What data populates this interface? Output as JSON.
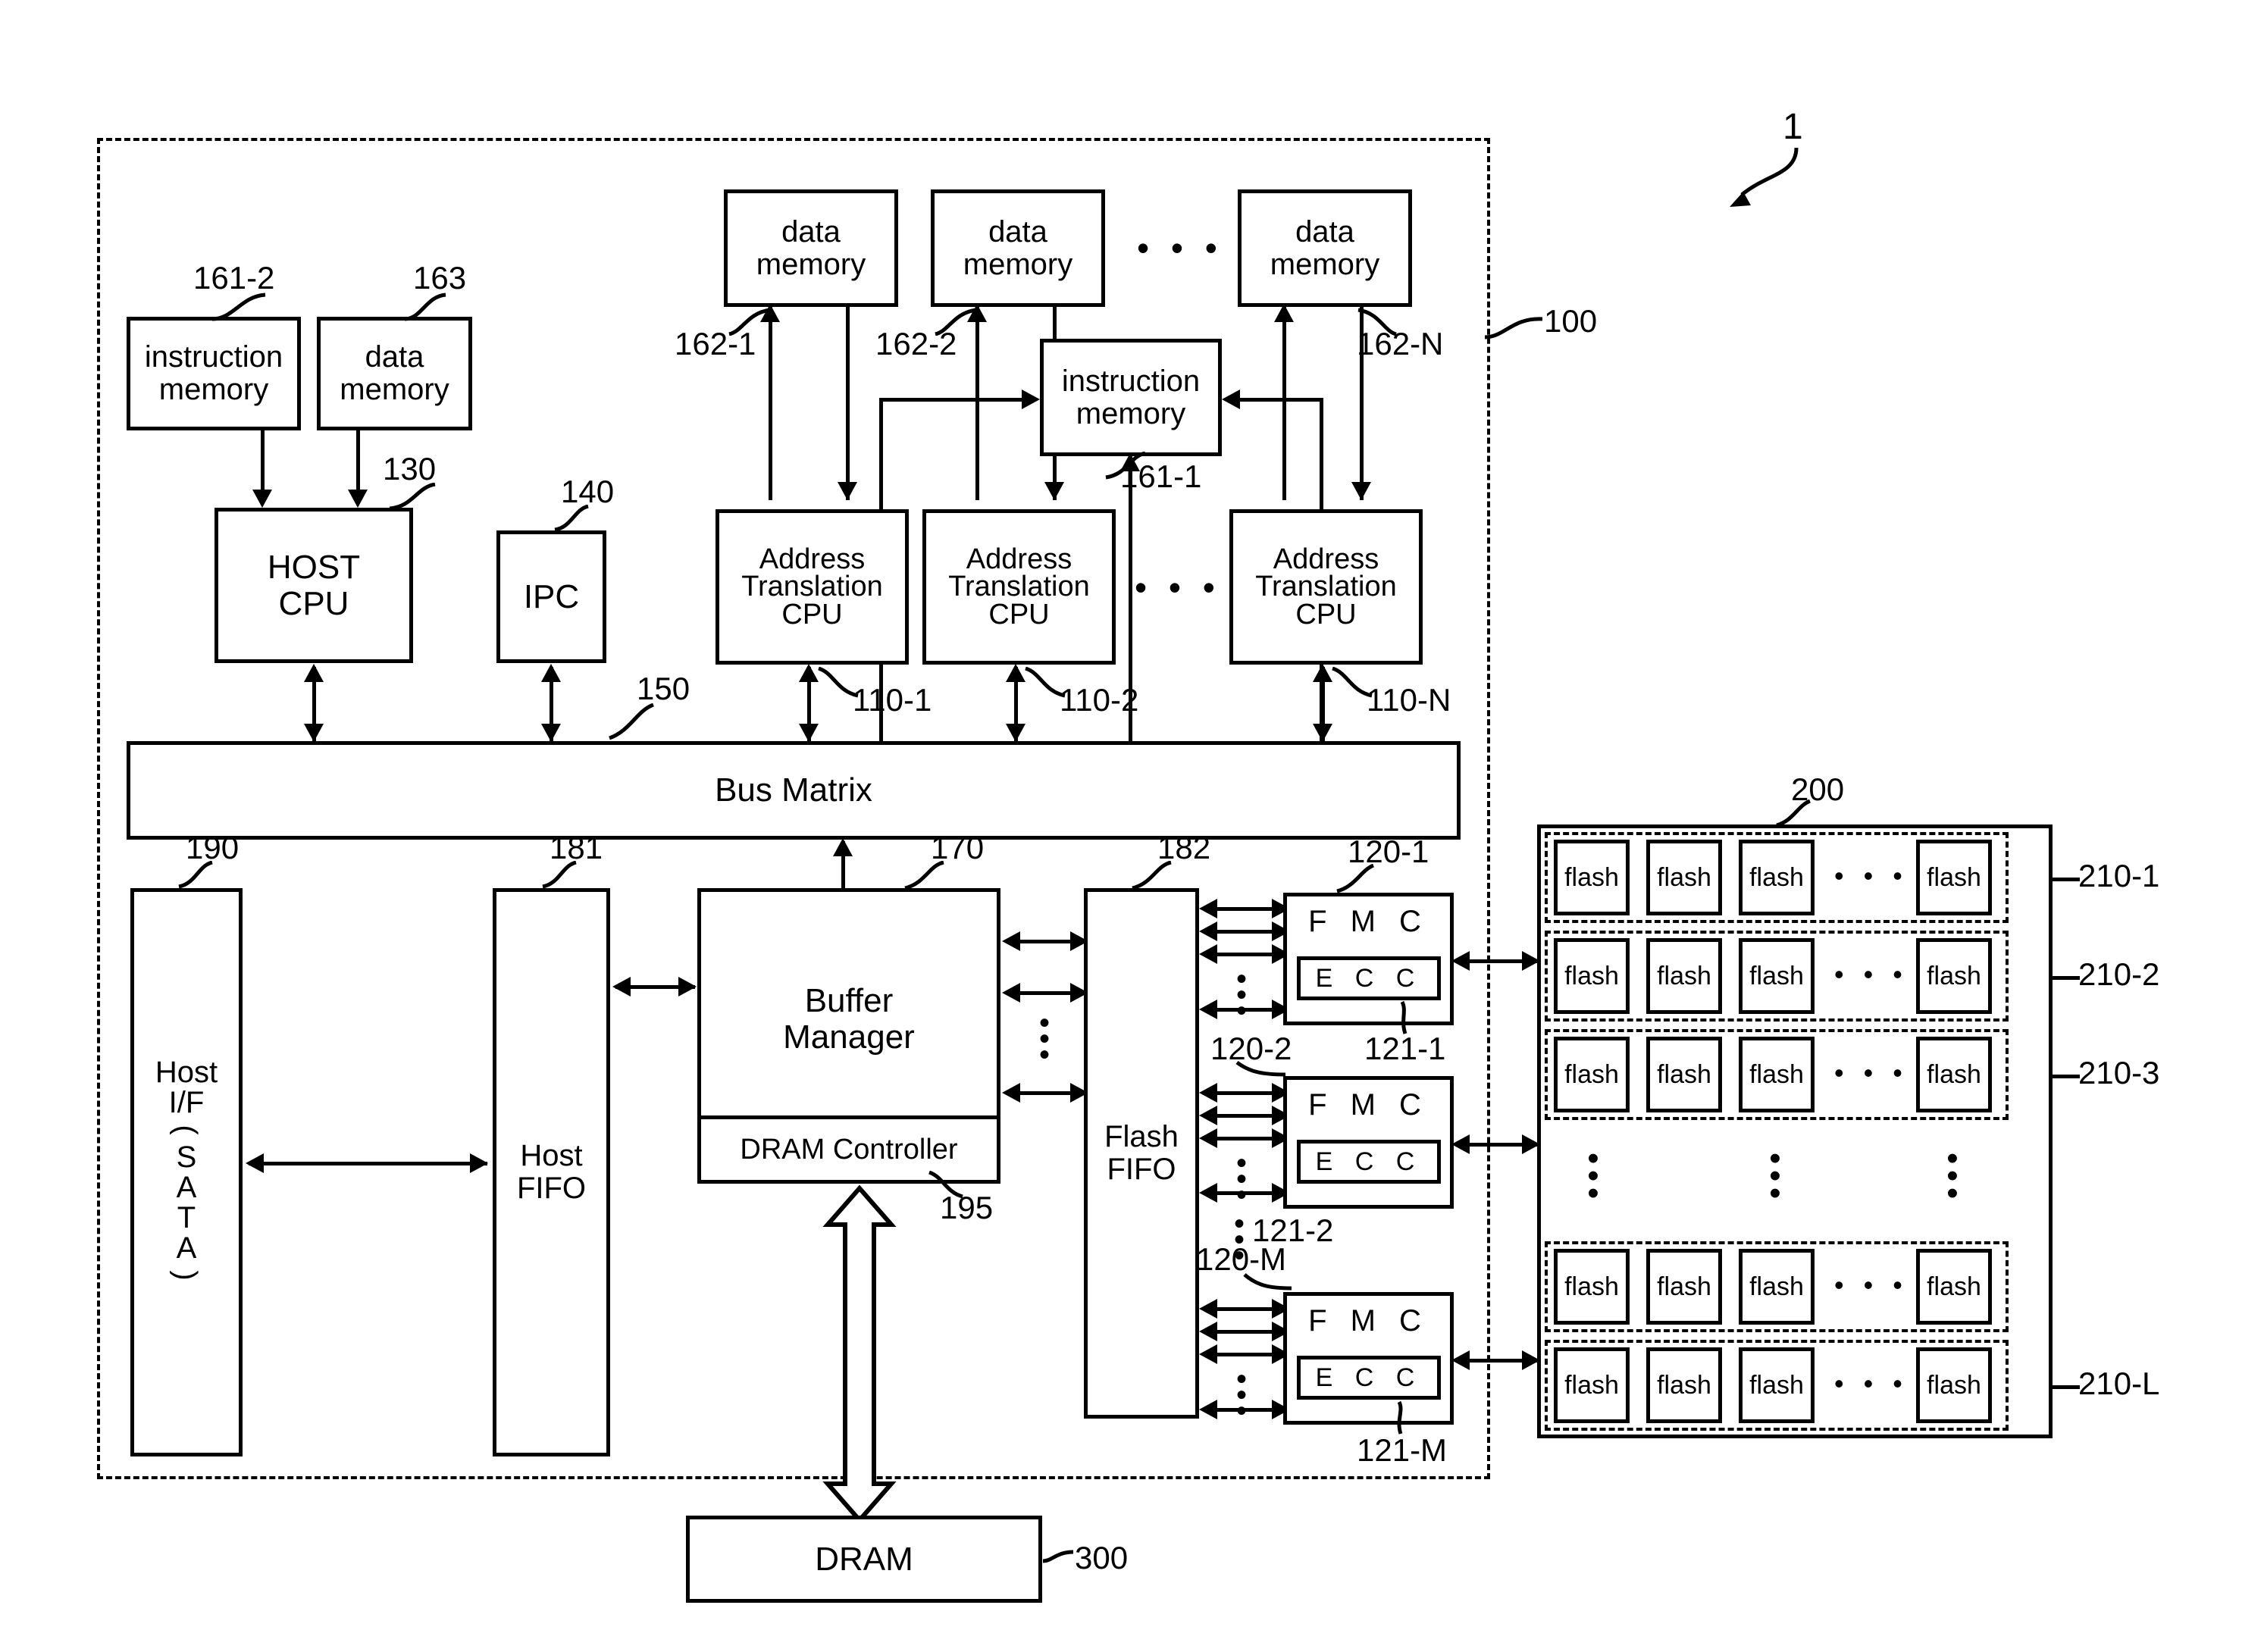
{
  "figure": {
    "overall_ref": "1",
    "controller_ref": "100",
    "flash_array_ref": "200",
    "dram_ref": "300"
  },
  "controller": {
    "host_instruction_memory": {
      "line1": "instruction",
      "line2": "memory",
      "ref": "161-2"
    },
    "host_data_memory": {
      "line1": "data",
      "line2": "memory",
      "ref": "163"
    },
    "host_cpu": {
      "line1": "HOST",
      "line2": "CPU",
      "ref": "130"
    },
    "ipc": {
      "label": "IPC",
      "ref": "140"
    },
    "bus_matrix": {
      "label": "Bus Matrix",
      "ref": "150"
    },
    "atc_instruction_memory": {
      "line1": "instruction",
      "line2": "memory",
      "ref": "161-1"
    },
    "data_memories": [
      {
        "line1": "data",
        "line2": "memory",
        "ref": "162-1"
      },
      {
        "line1": "data",
        "line2": "memory",
        "ref": "162-2"
      },
      {
        "line1": "data",
        "line2": "memory",
        "ref": "162-N"
      }
    ],
    "data_memory_ellipsis": "• • •",
    "address_translation_cpus": [
      {
        "line1": "Address",
        "line2": "Translation",
        "line3": "CPU",
        "ref": "110-1"
      },
      {
        "line1": "Address",
        "line2": "Translation",
        "line3": "CPU",
        "ref": "110-2"
      },
      {
        "line1": "Address",
        "line2": "Translation",
        "line3": "CPU",
        "ref": "110-N"
      }
    ],
    "atc_ellipsis": "• • •",
    "host_if": {
      "line1": "Host",
      "line2": "I/F",
      "paren_open": "(",
      "vertical": [
        "S",
        "A",
        "T",
        "A"
      ],
      "paren_close": ")",
      "ref": "190"
    },
    "host_fifo": {
      "line1": "Host",
      "line2": "FIFO",
      "ref": "181"
    },
    "buffer_manager": {
      "line1": "Buffer",
      "line2": "Manager",
      "ref": "170"
    },
    "dram_controller": {
      "label": "DRAM Controller",
      "ref": "195"
    },
    "flash_fifo": {
      "line1": "Flash",
      "line2": "FIFO",
      "ref": "182"
    },
    "fmcs": [
      {
        "label": "F M C",
        "ecc": "E C C",
        "ref": "120-1",
        "ecc_ref": "121-1"
      },
      {
        "label": "F M C",
        "ecc": "E C C",
        "ref": "120-2",
        "ecc_ref": "121-2"
      },
      {
        "label": "F M C",
        "ecc": "E C C",
        "ref": "120-M",
        "ecc_ref": "121-M"
      }
    ],
    "fmc_vertical_ellipsis": "⋮"
  },
  "flash_array": {
    "chip_label": "flash",
    "row_ellipsis": "• • •",
    "column_ellipsis": "⋮",
    "rows": [
      {
        "ref": "210-1",
        "chips": [
          "flash",
          "flash",
          "flash",
          "flash"
        ]
      },
      {
        "ref": "210-2",
        "chips": [
          "flash",
          "flash",
          "flash",
          "flash"
        ]
      },
      {
        "ref": "210-3",
        "chips": [
          "flash",
          "flash",
          "flash",
          "flash"
        ]
      },
      {
        "ref": "",
        "chips": [
          "flash",
          "flash",
          "flash",
          "flash"
        ]
      },
      {
        "ref": "210-L",
        "chips": [
          "flash",
          "flash",
          "flash",
          "flash"
        ]
      }
    ]
  },
  "dram": {
    "label": "DRAM",
    "ref": "300"
  }
}
